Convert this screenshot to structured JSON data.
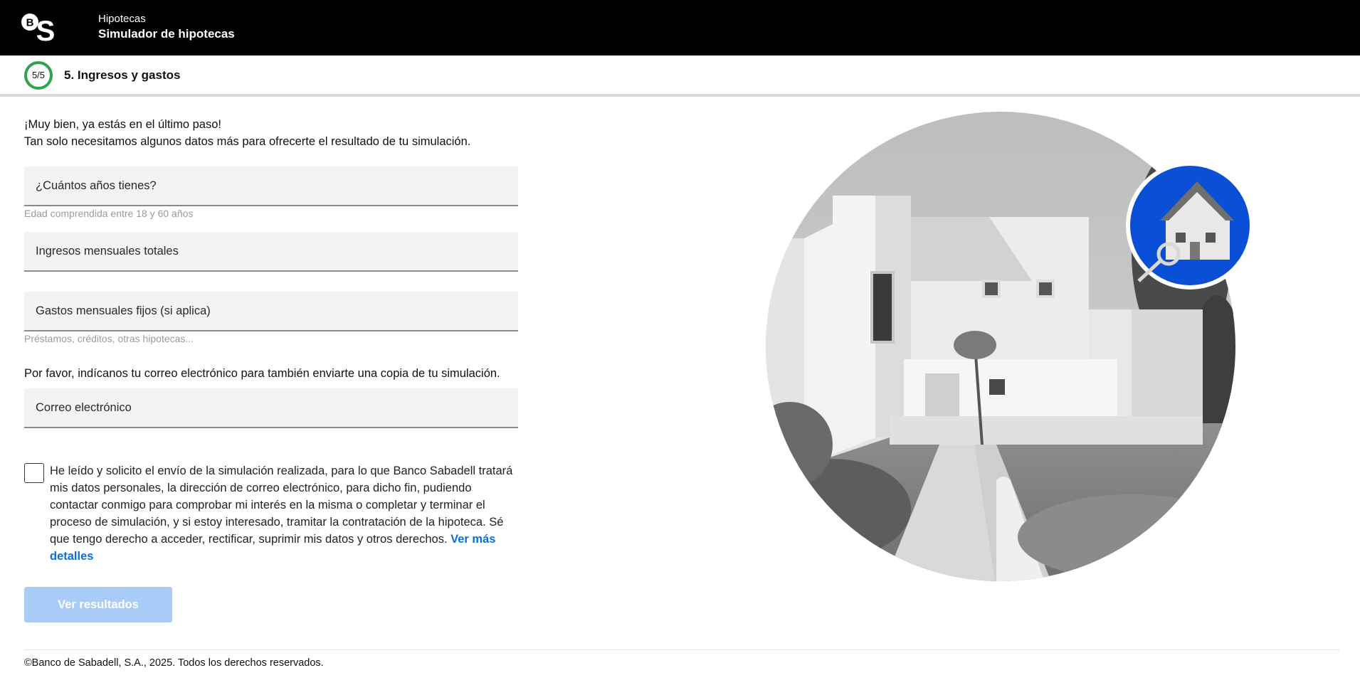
{
  "header": {
    "section": "Hipotecas",
    "title": "Simulador de hipotecas"
  },
  "step": {
    "counter": "5/5",
    "progress": 1.0,
    "title": "5. Ingresos y gastos"
  },
  "intro": {
    "line1": "¡Muy bien, ya estás en el último paso!",
    "line2": "Tan solo necesitamos algunos datos más para ofrecerte el resultado de tu simulación."
  },
  "form": {
    "age": {
      "placeholder": "¿Cuántos años tienes?",
      "value": "",
      "hint": "Edad comprendida entre 18 y 60 años"
    },
    "income": {
      "placeholder": "Ingresos mensuales totales",
      "value": ""
    },
    "expenses": {
      "placeholder": "Gastos mensuales fijos (si aplica)",
      "value": "",
      "hint": "Préstamos, créditos, otras hipotecas..."
    },
    "email_intro": "Por favor, indícanos tu correo electrónico para también enviarte una copia de tu simulación.",
    "email": {
      "placeholder": "Correo electrónico",
      "value": ""
    },
    "consent": {
      "checked": false,
      "text": "He leído y solicito el envío de la simulación realizada, para lo que Banco Sabadell tratará mis datos personales, la dirección de correo electrónico, para dicho fin, pudiendo contactar conmigo para comprobar mi interés en la misma o completar y terminar el proceso de simulación, y si estoy interesado, tramitar la contratación de la hipoteca. Sé que tengo derecho a acceder, rectificar, suprimir mis datos y otros derechos.",
      "link": "Ver más detalles"
    },
    "submit_label": "Ver resultados"
  },
  "footer": {
    "copyright": "©Banco de Sabadell, S.A., 2025. Todos los derechos reservados."
  },
  "colors": {
    "header_bg": "#000000",
    "progress_green": "#2ea44f",
    "link_blue": "#0b6fd6",
    "button_disabled": "#a8ccf7",
    "badge_blue": "#0a4fd6"
  },
  "icons": {
    "logo": "bs-logo-icon",
    "badge": "house-keys-icon"
  }
}
